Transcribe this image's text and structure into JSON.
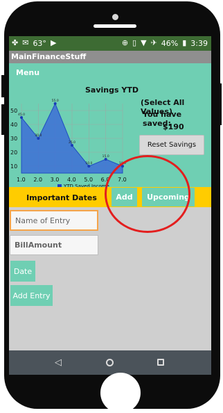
{
  "status_bar": {
    "temperature": "63°",
    "battery": "46%",
    "time": "3:39"
  },
  "app": {
    "title": "MainFinanceStuff",
    "menu_label": "Menu"
  },
  "savings": {
    "chart_title": "Savings YTD",
    "select_all_label": "(Select All Values)",
    "saved_text": "You have saved:",
    "amount": "$190",
    "reset_label": "Reset Savings"
  },
  "chart_data": {
    "type": "area",
    "title": "Savings YTD",
    "x": [
      1.0,
      2.0,
      3.0,
      4.0,
      5.0,
      6.0,
      7.0
    ],
    "series": [
      {
        "name": "YTD Saved Income",
        "values": [
          45.0,
          30.0,
          55.0,
          25.0,
          10.0,
          15.0,
          10.0
        ]
      }
    ],
    "xlim": [
      1.0,
      7.0
    ],
    "ylim": [
      5,
      55
    ],
    "yticks": [
      "10",
      "20",
      "30",
      "40",
      "50"
    ],
    "xticks": [
      "1.0",
      "2.0",
      "3.0",
      "4.0",
      "5.0",
      "6.0",
      "7.0"
    ],
    "point_labels": [
      "45.0",
      "30.0",
      "55.0",
      "25.0",
      "10.0",
      "15.0",
      "10.0"
    ],
    "legend": "bottom-center",
    "grid": true,
    "color": "#3d6fd6"
  },
  "toolbar": {
    "important_dates_label": "Important Dates",
    "add_label": "Add",
    "upcoming_label": "Upcoming"
  },
  "form": {
    "name_placeholder": "Name of Entry",
    "amount_placeholder": "BillAmount",
    "date_label": "Date",
    "add_entry_label": "Add Entry"
  },
  "colors": {
    "accent_green": "#6fcfb3",
    "toolbar_yellow": "#ffcc00",
    "annotation_red": "#e31e1e"
  }
}
